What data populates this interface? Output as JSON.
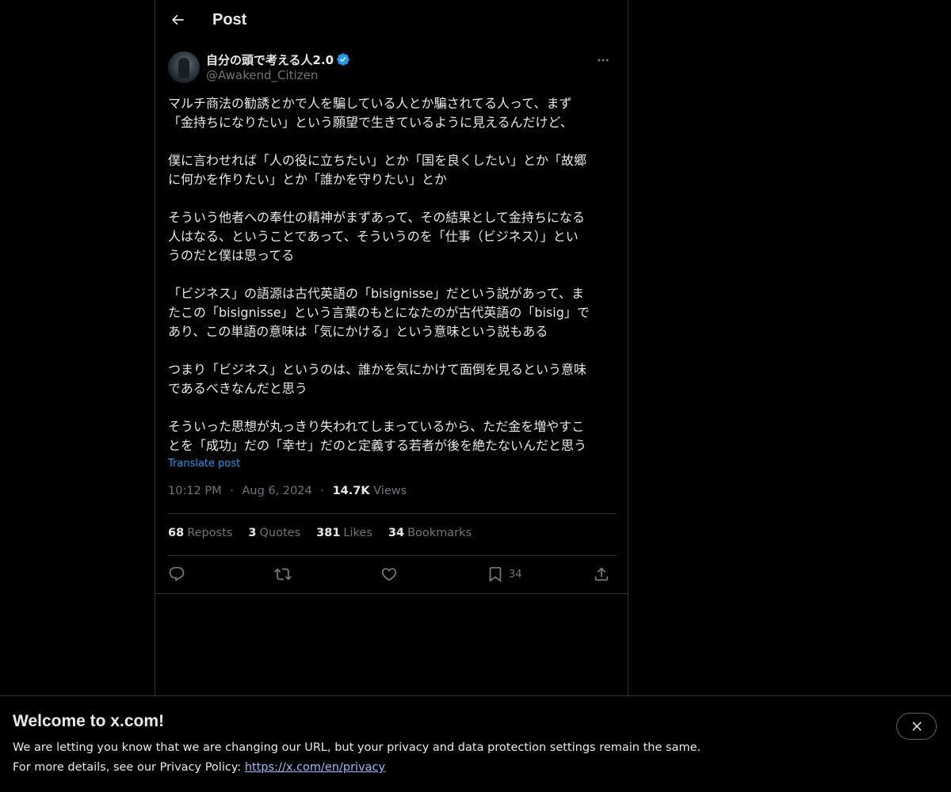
{
  "header": {
    "title": "Post"
  },
  "author": {
    "display_name": "自分の頭で考える人2.0",
    "handle": "@Awakend_Citizen",
    "verified": true
  },
  "tweet": {
    "paragraphs": [
      "マルチ商法の勧誘とかで人を騙している人とか騙されてる人って、まず\n「金持ちになりたい」という願望で生きているように見えるんだけど、",
      "僕に言わせれば「人の役に立ちたい」とか「国を良くしたい」とか「故郷\nに何かを作りたい」とか「誰かを守りたい」とか",
      "そういう他者への奉仕の精神がまずあって、その結果として金持ちになる\n人はなる、ということであって、そういうのを「仕事（ビジネス）」とい\nうのだと僕は思ってる",
      "「ビジネス」の語源は古代英語の「bisignisse」だという説があって、ま\nたこの「bisignisse」という言葉のもとになたのが古代英語の「bisig」で\nあり、この単語の意味は「気にかける」という意味という説もある",
      "つまり「ビジネス」というのは、誰かを気にかけて面倒を見るという意味\nであるべきなんだと思う",
      "そういった思想が丸っきり失われてしまっているから、ただ金を増やすこ\nとを「成功」だの「幸せ」だのと定義する若者が後を絶たないんだと思う"
    ],
    "translate_label": "Translate post",
    "time": "10:12 PM",
    "date": "Aug 6, 2024",
    "separator": "·",
    "views_count": "14.7K",
    "views_label": "Views"
  },
  "stats": {
    "reposts": {
      "count": "68",
      "label": "Reposts"
    },
    "quotes": {
      "count": "3",
      "label": "Quotes"
    },
    "likes": {
      "count": "381",
      "label": "Likes"
    },
    "bookmarks": {
      "count": "34",
      "label": "Bookmarks"
    }
  },
  "actions": {
    "bookmark_count": "34"
  },
  "banner": {
    "title": "Welcome to x.com!",
    "line1": "We are letting you know that we are changing our URL, but your privacy and data protection settings remain the same.",
    "line2_prefix": "For more details, see our Privacy Policy: ",
    "link_text": "https://x.com/en/privacy"
  },
  "colors": {
    "background": "#000000",
    "text_primary": "#e7e9ea",
    "text_secondary": "#71767b",
    "accent": "#1d9bf0",
    "border": "#2f3336",
    "link": "#a3b6ff"
  },
  "icons": [
    "back-arrow-icon",
    "verified-badge-icon",
    "more-options-icon",
    "reply-icon",
    "repost-icon",
    "like-icon",
    "bookmark-icon",
    "share-icon",
    "close-icon"
  ]
}
